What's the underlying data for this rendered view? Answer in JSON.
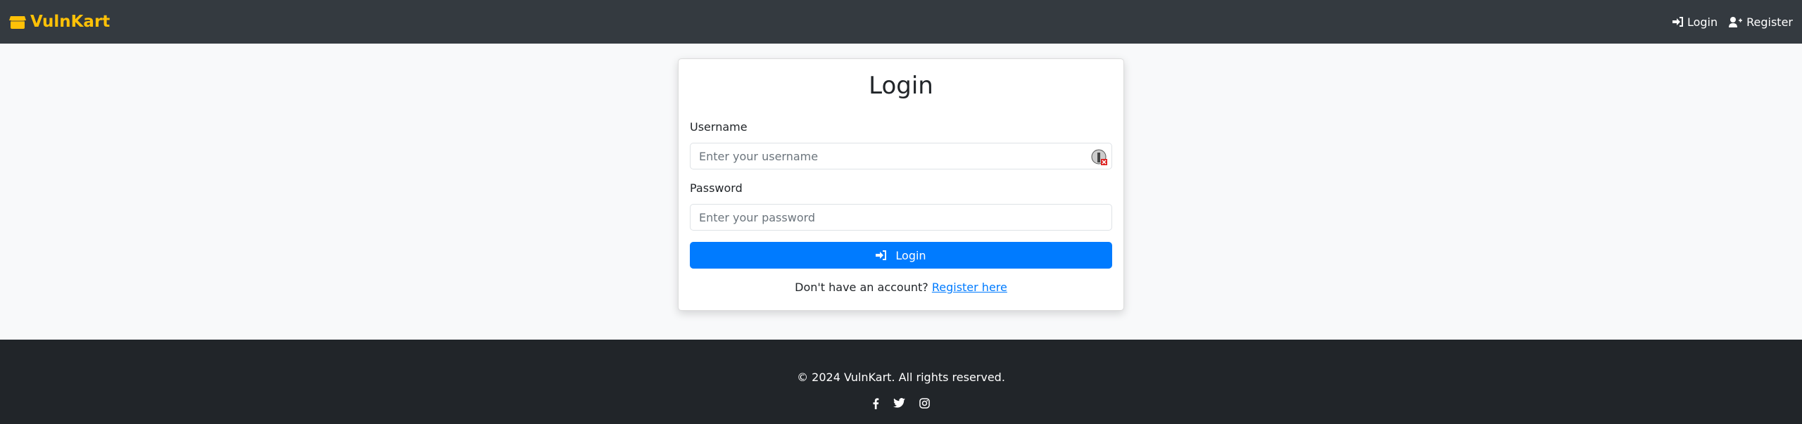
{
  "navbar": {
    "brand": "VulnKart",
    "links": [
      {
        "label": "Login",
        "icon": "sign-in-icon"
      },
      {
        "label": "Register",
        "icon": "user-plus-icon"
      }
    ]
  },
  "login": {
    "title": "Login",
    "username_label": "Username",
    "username_placeholder": "Enter your username",
    "password_label": "Password",
    "password_placeholder": "Enter your password",
    "submit_label": "Login",
    "register_prompt": "Don't have an account?",
    "register_link": "Register here"
  },
  "footer": {
    "copyright": "© 2024 VulnKart. All rights reserved.",
    "social": [
      "facebook-icon",
      "twitter-icon",
      "instagram-icon"
    ]
  },
  "colors": {
    "navbar": "#343a40",
    "brand": "#ffc107",
    "primary": "#007bff",
    "footer": "#212529"
  }
}
